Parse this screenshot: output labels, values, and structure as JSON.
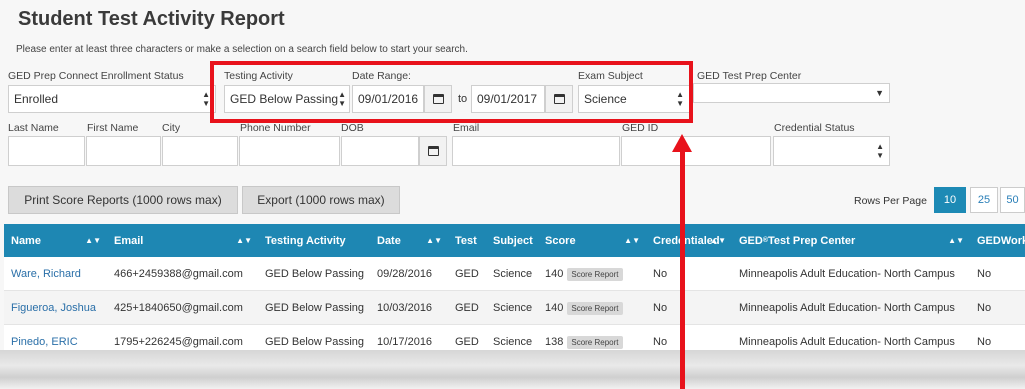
{
  "page": {
    "title": "Student Test Activity Report",
    "hint": "Please enter at least three characters or make a selection on a search field below to start your search."
  },
  "filters": {
    "enrollment_label": "GED Prep Connect Enrollment Status",
    "enrollment_value": "Enrolled",
    "testing_activity_label": "Testing Activity",
    "testing_activity_value": "GED Below Passing",
    "date_range_label": "Date Range:",
    "date_from": "09/01/2016",
    "date_to_word": "to",
    "date_to": "09/01/2017",
    "exam_subject_label": "Exam Subject",
    "exam_subject_value": "Science",
    "prep_center_label": "GED Test Prep Center",
    "last_name_label": "Last Name",
    "first_name_label": "First Name",
    "city_label": "City",
    "phone_label": "Phone Number",
    "dob_label": "DOB",
    "email_label": "Email",
    "ged_id_label": "GED ID",
    "credential_label": "Credential Status"
  },
  "toolbar": {
    "print_label": "Print Score Reports (1000 rows max)",
    "export_label": "Export (1000 rows max)",
    "rows_per_page_label": "Rows Per Page",
    "page_sizes": [
      "10",
      "25",
      "50"
    ]
  },
  "table": {
    "headers": {
      "name": "Name",
      "email": "Email",
      "activity": "Testing Activity",
      "date": "Date",
      "test": "Test",
      "subject": "Subject",
      "score": "Score",
      "credentialed": "Credentialed",
      "center_prefix": "GED",
      "center_suffix": " Test Prep Center",
      "works": "GEDWorks"
    },
    "score_report_label": "Score Report",
    "rows": [
      {
        "name": "Ware, Richard",
        "email": "466+2459388@gmail.com",
        "activity": "GED Below Passing",
        "date": "09/28/2016",
        "test": "GED",
        "subject": "Science",
        "score": "140",
        "credentialed": "No",
        "center": "Minneapolis Adult Education- North Campus",
        "works": "No"
      },
      {
        "name": "Figueroa, Joshua",
        "email": "425+1840650@gmail.com",
        "activity": "GED Below Passing",
        "date": "10/03/2016",
        "test": "GED",
        "subject": "Science",
        "score": "140",
        "credentialed": "No",
        "center": "Minneapolis Adult Education- North Campus",
        "works": "No"
      },
      {
        "name": "Pinedo, ERIC",
        "email": "1795+226245@gmail.com",
        "activity": "GED Below Passing",
        "date": "10/17/2016",
        "test": "GED",
        "subject": "Science",
        "score": "138",
        "credentialed": "No",
        "center": "Minneapolis Adult Education- North Campus",
        "works": "No"
      }
    ]
  },
  "colors": {
    "header_blue": "#1e87b3",
    "annotation_red": "#e8121b"
  }
}
